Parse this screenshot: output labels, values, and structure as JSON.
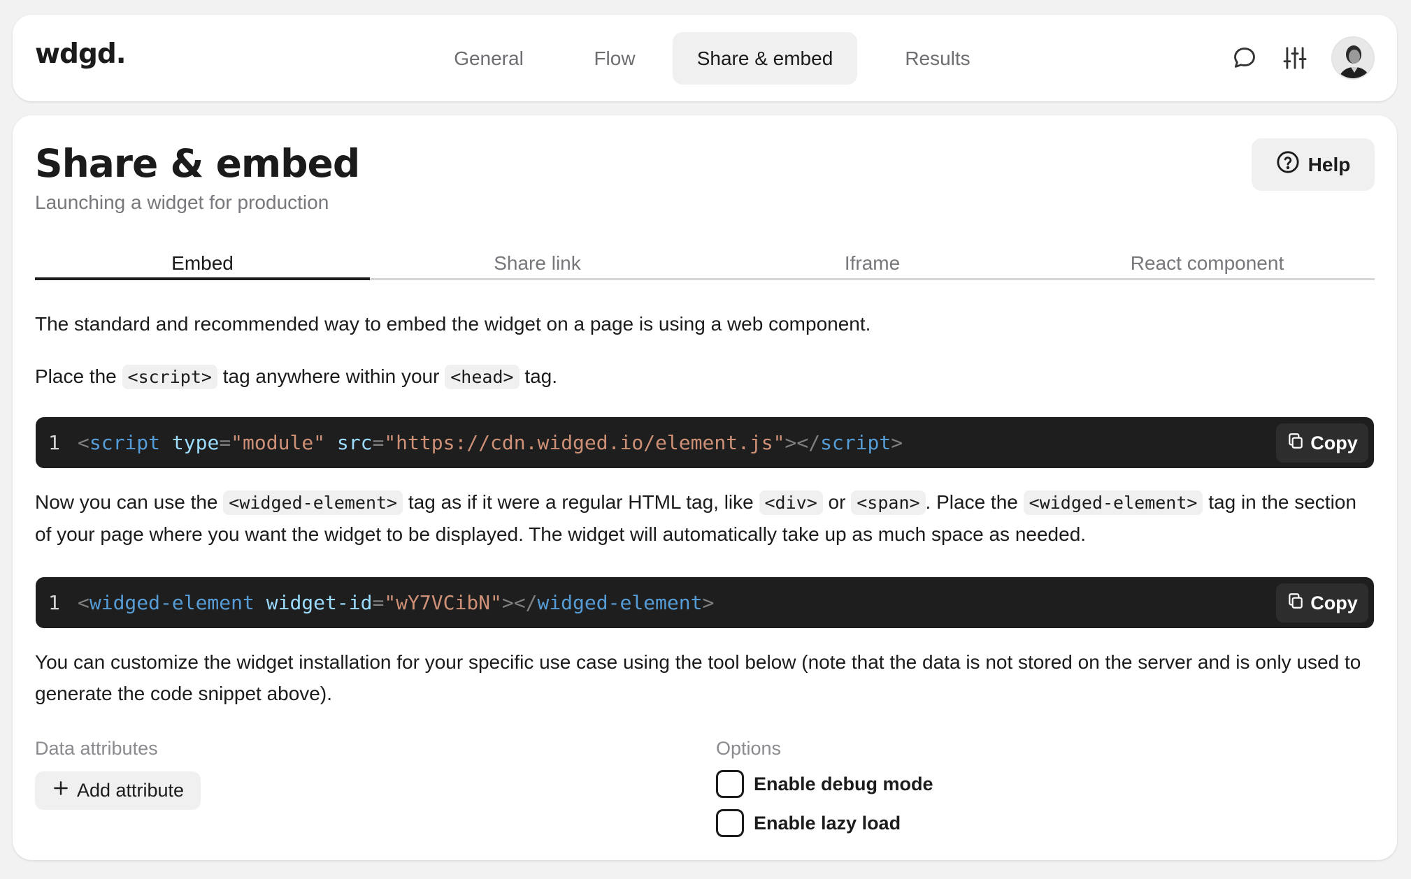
{
  "header": {
    "logo": "wdgd.",
    "nav": [
      {
        "label": "General"
      },
      {
        "label": "Flow"
      },
      {
        "label": "Share & embed"
      },
      {
        "label": "Results"
      }
    ],
    "icons": [
      "chat-icon",
      "sliders-icon",
      "avatar"
    ]
  },
  "page": {
    "title": "Share & embed",
    "subtitle": "Launching a widget for production",
    "help_label": "Help"
  },
  "tabs": [
    {
      "label": "Embed"
    },
    {
      "label": "Share link"
    },
    {
      "label": "Iframe"
    },
    {
      "label": "React component"
    }
  ],
  "content": {
    "intro": "The standard and recommended way to embed the widget on a page is using a web component.",
    "place_1": "Place the ",
    "place_code_1": "<script>",
    "place_2": " tag anywhere within your ",
    "place_code_2": "<head>",
    "place_3": " tag.",
    "code1": {
      "line": "1",
      "tag_open": "script",
      "attr1": "type",
      "val1": "\"module\"",
      "attr2": "src",
      "val2": "\"https://cdn.widged.io/element.js\"",
      "tag_close": "script",
      "copy_label": "Copy"
    },
    "now_1": "Now you can use the ",
    "now_code_1": "<widged-element>",
    "now_2": " tag as if it were a regular HTML tag, like ",
    "now_code_2": "<div>",
    "now_3": " or ",
    "now_code_3": "<span>",
    "now_4": ". Place the ",
    "now_code_4": "<widged-element>",
    "now_5": " tag in the section of your page where you want the widget to be displayed. The widget will automatically take up as much space as needed.",
    "code2": {
      "line": "1",
      "tag_open": "widged-element",
      "attr1": "widget-id",
      "val1": "\"wY7VCibN\"",
      "tag_close": "widged-element",
      "copy_label": "Copy"
    },
    "customize": "You can customize the widget installation for your specific use case using the tool below (note that the data is not stored on the server and is only used to generate the code snippet above)."
  },
  "attributes": {
    "label": "Data attributes",
    "add_label": "Add attribute"
  },
  "options": {
    "label": "Options",
    "items": [
      {
        "label": "Enable debug mode",
        "checked": false
      },
      {
        "label": "Enable lazy load",
        "checked": false
      }
    ]
  }
}
